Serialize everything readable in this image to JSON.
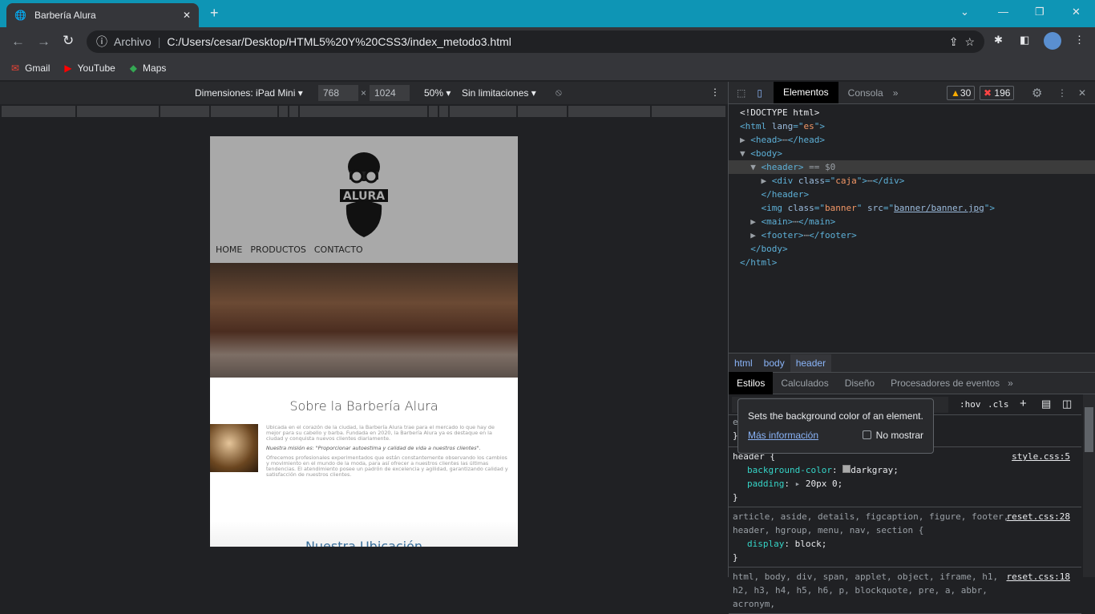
{
  "browser": {
    "tab_title": "Barbería Alura",
    "address_prefix": "Archivo",
    "url": "C:/Users/cesar/Desktop/HTML5%20Y%20CSS3/index_metodo3.html",
    "bookmarks": [
      {
        "label": "Gmail",
        "color": "#ea4335"
      },
      {
        "label": "YouTube",
        "color": "#ff0000"
      },
      {
        "label": "Maps",
        "color": "#34a853"
      }
    ]
  },
  "device_toolbar": {
    "dimensions": "Dimensiones: iPad Mini",
    "width": "768",
    "height": "1024",
    "zoom": "50%",
    "throttle": "Sin limitaciones"
  },
  "site": {
    "nav": [
      "HOME",
      "PRODUCTOS",
      "CONTACTO"
    ],
    "logo_text": "ALURA",
    "about_title": "Sobre la Barbería Alura",
    "p1": "Ubicada en el corazón de la ciudad, la Barbería Alura trae para el mercado lo que hay de mejor para su cabello y barba. Fundada en 2020, la Barbería Alura ya es destaque en la ciudad y conquista nuevos clientes diariamente.",
    "p2": "Nuestra misión es: \"Proporcionar autoestima y calidad de vida a nuestros clientes\".",
    "p3": "Ofrecemos profesionales experimentados que están constantemente observando los cambios y movimiento en el mundo de la moda, para así ofrecer a nuestros clientes las últimas tendencias. El atendimiento posee un padrón de excelencia y agilidad, garantizando calidad y satisfacción de nuestros clientes.",
    "location_title": "Nuestra Ubicación"
  },
  "devtools": {
    "tabs": [
      "Elementos",
      "Consola"
    ],
    "warnings": "30",
    "errors": "196",
    "dom": [
      [
        [
          "<!DOCTYPE html>",
          "pl"
        ]
      ],
      [
        [
          "<html ",
          "tg"
        ],
        [
          "lang",
          "at"
        ],
        [
          "=\"",
          "tg"
        ],
        [
          "es",
          "av"
        ],
        [
          "\">",
          "tg"
        ]
      ],
      [
        [
          "▶ ",
          "gr"
        ],
        [
          "<head>",
          "tg"
        ],
        [
          "⋯",
          "gr"
        ],
        [
          "</head>",
          "tg"
        ]
      ],
      [
        [
          "▼ ",
          "gr"
        ],
        [
          "<body>",
          "tg"
        ]
      ],
      [
        [
          "  ▼ ",
          "gr"
        ],
        [
          "<header>",
          "tg"
        ],
        [
          " == $0",
          "gr"
        ]
      ],
      [
        [
          "    ▶ ",
          "gr"
        ],
        [
          "<div ",
          "tg"
        ],
        [
          "class",
          "at"
        ],
        [
          "=\"",
          "tg"
        ],
        [
          "caja",
          "av"
        ],
        [
          "\">",
          "tg"
        ],
        [
          "⋯",
          "gr"
        ],
        [
          "</div>",
          "tg"
        ]
      ],
      [
        [
          "    ",
          "pl"
        ],
        [
          "</header>",
          "tg"
        ]
      ],
      [
        [
          "    ",
          "pl"
        ],
        [
          "<img ",
          "tg"
        ],
        [
          "class",
          "at"
        ],
        [
          "=\"",
          "tg"
        ],
        [
          "banner",
          "av"
        ],
        [
          "\" ",
          "tg"
        ],
        [
          "src",
          "at"
        ],
        [
          "=\"",
          "tg"
        ],
        [
          "banner/banner.jpg",
          "lk"
        ],
        [
          "\">",
          "tg"
        ]
      ],
      [
        [
          "  ▶ ",
          "gr"
        ],
        [
          "<main>",
          "tg"
        ],
        [
          "⋯",
          "gr"
        ],
        [
          "</main>",
          "tg"
        ]
      ],
      [
        [
          "  ▶ ",
          "gr"
        ],
        [
          "<footer>",
          "tg"
        ],
        [
          "⋯",
          "gr"
        ],
        [
          "</footer>",
          "tg"
        ]
      ],
      [
        [
          "  ",
          "pl"
        ],
        [
          "</body>",
          "tg"
        ]
      ],
      [
        [
          "</html>",
          "tg"
        ]
      ]
    ],
    "breadcrumbs": [
      "html",
      "body",
      "header"
    ],
    "style_tabs": [
      "Estilos",
      "Calculados",
      "Diseño",
      "Procesadores de eventos"
    ],
    "filter_buttons": [
      ":hov",
      ".cls"
    ],
    "tooltip": {
      "text": "Sets the background color of an element.",
      "link": "Más información",
      "checkbox": "No mostrar"
    },
    "rules": [
      {
        "selector": "header {",
        "source": "style.css:5",
        "props": [
          [
            "background-color",
            "darkgray"
          ],
          [
            "padding",
            "20px 0"
          ]
        ]
      },
      {
        "selector": "article, aside, details, figcaption, figure, footer, header, hgroup, menu, nav, section {",
        "source": "reset.css:28",
        "props": [
          [
            "display",
            "block"
          ]
        ]
      },
      {
        "selector": "html, body, div, span, applet, object, iframe, h1, h2, h3, h4, h5, h6, p, blockquote, pre, a, abbr, acronym,",
        "source": "reset.css:18",
        "props": []
      }
    ],
    "swatch_color": "#a9a9a9"
  }
}
